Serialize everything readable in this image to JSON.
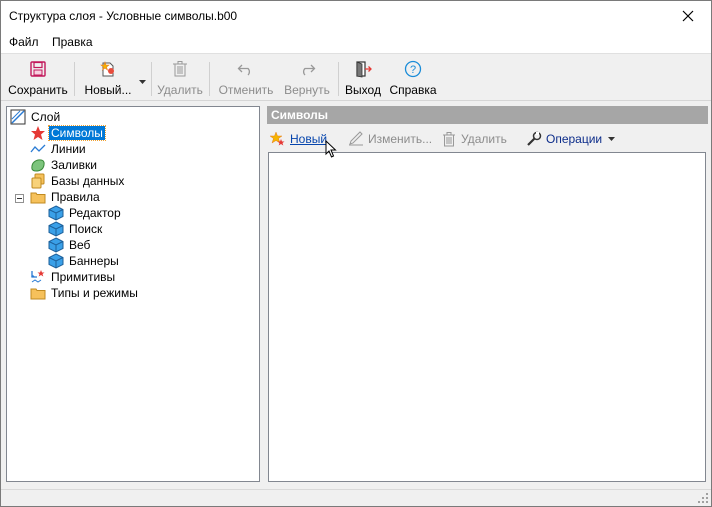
{
  "window": {
    "title": "Структура слоя - Условные символы.b00"
  },
  "menu": {
    "file": "Файл",
    "edit": "Правка"
  },
  "toolbar": {
    "save": "Сохранить",
    "new": "Новый...",
    "delete": "Удалить",
    "undo": "Отменить",
    "redo": "Вернуть",
    "exit": "Выход",
    "help": "Справка"
  },
  "tree": {
    "root": "Слой",
    "symbols": "Символы",
    "lines": "Линии",
    "fills": "Заливки",
    "databases": "Базы данных",
    "rules": "Правила",
    "editor": "Редактор",
    "search": "Поиск",
    "web": "Веб",
    "banners": "Баннеры",
    "primitives": "Примитивы",
    "types": "Типы и режимы"
  },
  "panel": {
    "header": "Символы",
    "new": "Новый",
    "edit": "Изменить...",
    "delete": "Удалить",
    "operations": "Операции"
  },
  "colors": {
    "selection": "#0078d7",
    "panel_header": "#a6a6a6",
    "link": "#0645ad",
    "save_icon": "#c2185b",
    "help_icon": "#1a8cd8",
    "cube": "#3aa0e8",
    "folder": "#f6c15b"
  }
}
